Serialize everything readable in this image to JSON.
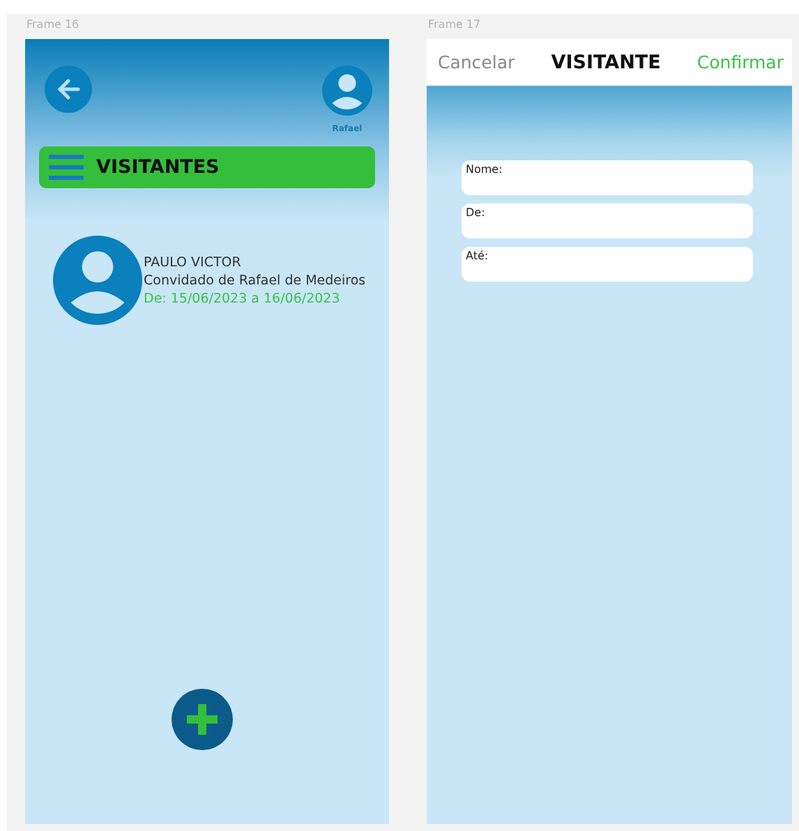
{
  "frames": [
    {
      "label": "Frame 16"
    },
    {
      "label": "Frame 17"
    }
  ],
  "list_screen": {
    "user_name": "Rafael",
    "title": "VISITANTES",
    "visitors": [
      {
        "name": "PAULO VICTOR",
        "host": "Convidado de Rafael de Medeiros",
        "period": "De: 15/06/2023 a 16/06/2023"
      }
    ]
  },
  "form_screen": {
    "cancel": "Cancelar",
    "title": "VISITANTE",
    "confirm": "Confirmar",
    "fields": [
      {
        "label": "Nome:"
      },
      {
        "label": "De:"
      },
      {
        "label": "Até:"
      }
    ]
  }
}
